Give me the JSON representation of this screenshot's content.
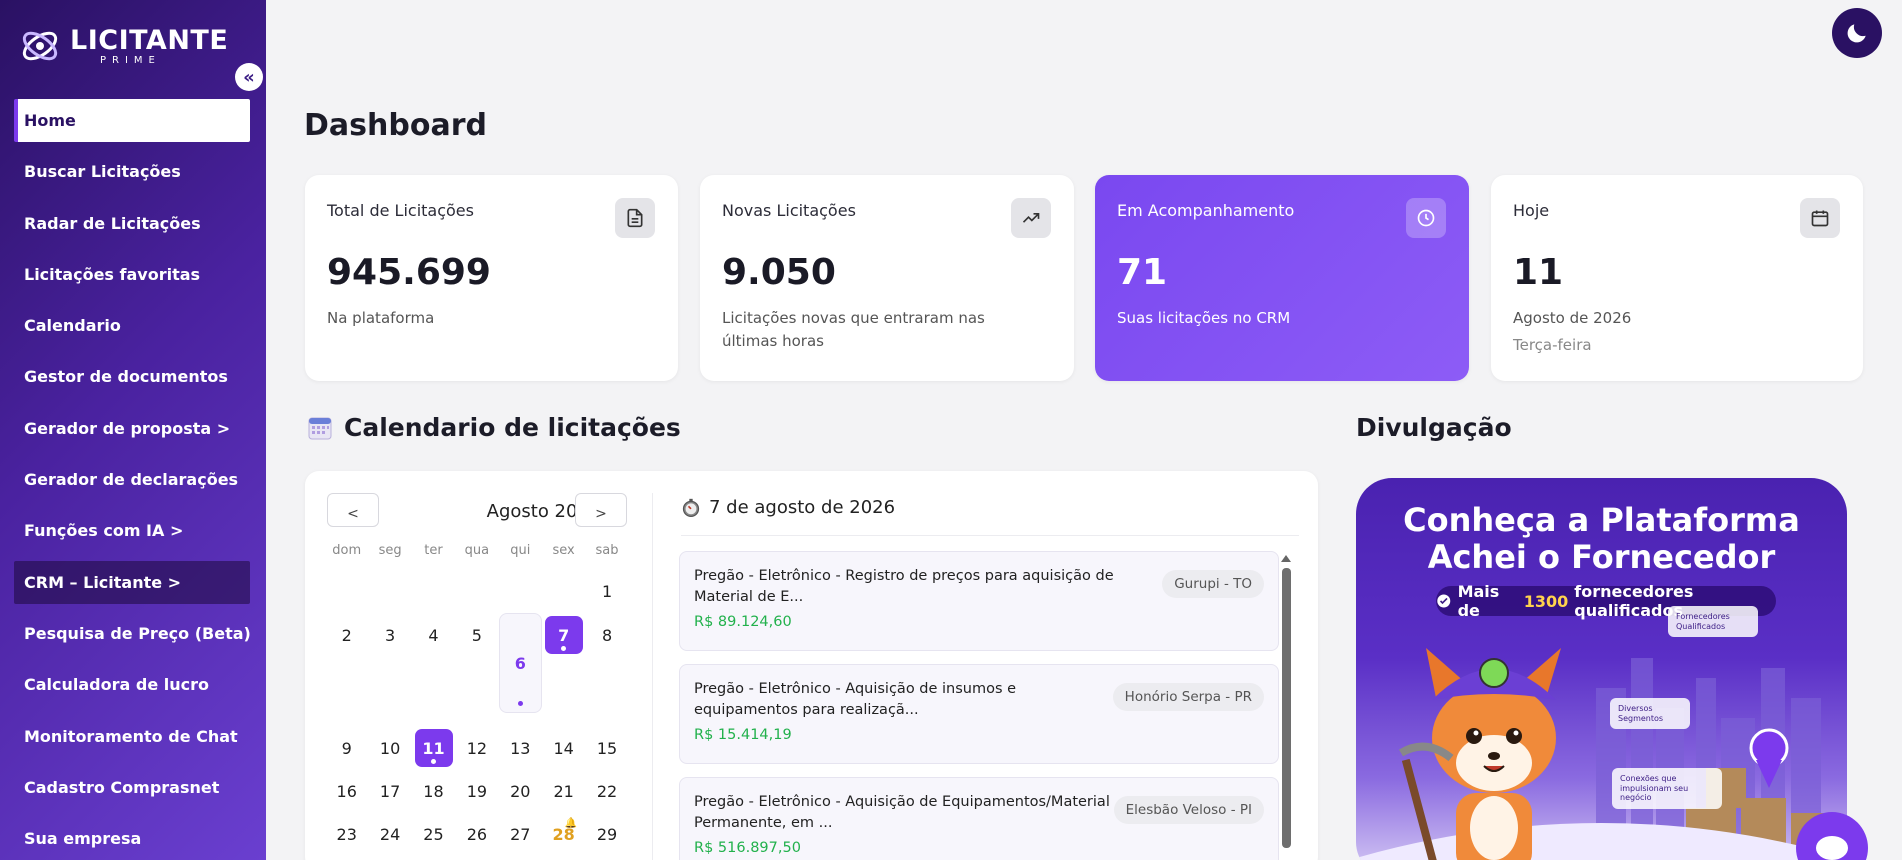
{
  "brand": {
    "title": "LICITANTE",
    "subtitle": "PRIME"
  },
  "sidebar": {
    "collapse_label": "«",
    "items": [
      {
        "label": "Home"
      },
      {
        "label": "Buscar Licitações"
      },
      {
        "label": "Radar de Licitações"
      },
      {
        "label": "Licitações favoritas"
      },
      {
        "label": "Calendario"
      },
      {
        "label": "Gestor de documentos"
      },
      {
        "label": "Gerador de proposta >"
      },
      {
        "label": "Gerador de declarações"
      },
      {
        "label": "Funções com IA >"
      },
      {
        "label": "CRM – Licitante >"
      },
      {
        "label": "Pesquisa de Preço (Beta)"
      },
      {
        "label": "Calculadora de lucro"
      },
      {
        "label": "Monitoramento de Chat"
      },
      {
        "label": "Cadastro Comprasnet"
      },
      {
        "label": "Sua empresa"
      }
    ]
  },
  "page": {
    "title": "Dashboard"
  },
  "cards": [
    {
      "label": "Total de Licitações",
      "value": "945.699",
      "desc": "Na plataforma",
      "icon": "document-icon"
    },
    {
      "label": "Novas Licitações",
      "value": "9.050",
      "desc": "Licitações novas que entraram nas últimas horas",
      "icon": "trending-up-icon"
    },
    {
      "label": "Em Acompanhamento",
      "value": "71",
      "desc": "Suas licitações no CRM",
      "icon": "clock-icon"
    },
    {
      "label": "Hoje",
      "value": "11",
      "desc": "Agosto de 2026",
      "desc2": "Terça-feira",
      "icon": "calendar-icon"
    }
  ],
  "calendar_section": {
    "title": "Calendario de licitações",
    "prev_label": "<",
    "next_label": ">",
    "month_label": "Agosto 2026",
    "weekdays": [
      "dom",
      "seg",
      "ter",
      "qua",
      "qui",
      "sex",
      "sab"
    ],
    "weeks": [
      [
        "",
        "",
        "",
        "",
        "",
        "",
        "1"
      ],
      [
        "2",
        "3",
        "4",
        "5",
        "6",
        "7",
        "8"
      ],
      [
        "9",
        "10",
        "11",
        "12",
        "13",
        "14",
        "15"
      ],
      [
        "16",
        "17",
        "18",
        "19",
        "20",
        "21",
        "22"
      ],
      [
        "23",
        "24",
        "25",
        "26",
        "27",
        "28",
        "29"
      ],
      [
        "30",
        "31",
        "",
        "",
        "",
        "",
        ""
      ]
    ],
    "selected_day": "7",
    "today_day": "11",
    "event_days": [
      "6"
    ],
    "alert_days": [
      "28"
    ],
    "day_title": "7 de agosto de 2026",
    "events": [
      {
        "title": "Pregão - Eletrônico - Registro de preços para aquisição de Material de E...",
        "price": "R$ 89.124,60",
        "location": "Gurupi - TO"
      },
      {
        "title": "Pregão - Eletrônico - Aquisição de insumos e equipamentos para realizaçã...",
        "price": "R$ 15.414,19",
        "location": "Honório Serpa - PR"
      },
      {
        "title": "Pregão - Eletrônico - Aquisição de Equipamentos/Material Permanente, em ...",
        "price": "R$ 516.897,50",
        "location": "Elesbão Veloso - PI"
      }
    ]
  },
  "promo": {
    "title": "Divulgação",
    "headline_line1": "Conheça a Plataforma",
    "headline_line2": "Achei o Fornecedor",
    "sub_before": "Mais de",
    "sub_highlight": "1300",
    "sub_after": "fornecedores qualificados",
    "badge1": "Fornecedores Qualificados",
    "badge2": "Diversos Segmentos",
    "badge3": "Conexões que impulsionam seu negócio"
  },
  "colors": {
    "accent": "#7c3aed",
    "sidebar_dark": "#2a1163",
    "price_green": "#22b14c",
    "alert": "#e0a020"
  }
}
